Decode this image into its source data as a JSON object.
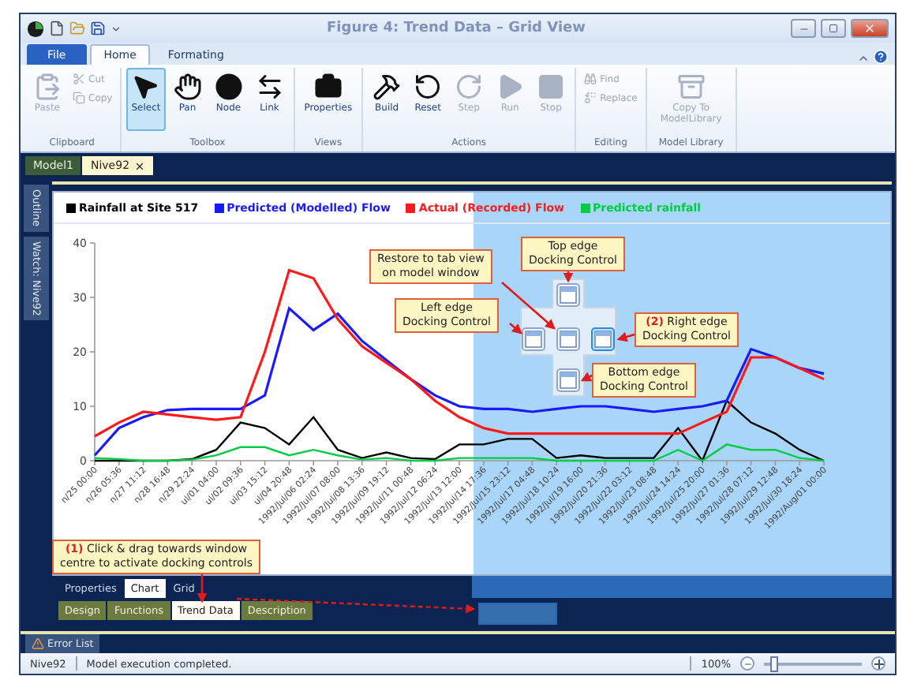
{
  "window": {
    "title": "Figure 4: Trend Data – Grid View"
  },
  "ribbon_tabs": [
    {
      "label": "File",
      "kind": "file",
      "selected": false
    },
    {
      "label": "Home",
      "kind": "tab",
      "selected": true
    },
    {
      "label": "Formating",
      "kind": "tab",
      "selected": false
    }
  ],
  "ribbon": {
    "groups": [
      {
        "label": "Clipboard",
        "buttons": [
          {
            "label": "Paste",
            "kind": "large",
            "disabled": true
          },
          {
            "label": "Cut",
            "kind": "small",
            "disabled": true
          },
          {
            "label": "Copy",
            "kind": "small",
            "disabled": true
          }
        ]
      },
      {
        "label": "Toolbox",
        "buttons": [
          {
            "label": "Select",
            "kind": "large",
            "disabled": false,
            "selected": true
          },
          {
            "label": "Pan",
            "kind": "large",
            "disabled": false,
            "selected": false
          },
          {
            "label": "Node",
            "kind": "large",
            "disabled": false,
            "selected": false
          },
          {
            "label": "Link",
            "kind": "large",
            "disabled": false,
            "selected": false
          }
        ]
      },
      {
        "label": "Views",
        "buttons": [
          {
            "label": "Properties",
            "kind": "large",
            "disabled": false
          }
        ]
      },
      {
        "label": "Actions",
        "buttons": [
          {
            "label": "Build",
            "kind": "large",
            "disabled": false
          },
          {
            "label": "Reset",
            "kind": "large",
            "disabled": false
          },
          {
            "label": "Step",
            "kind": "large",
            "disabled": true
          },
          {
            "label": "Run",
            "kind": "large",
            "disabled": true
          },
          {
            "label": "Stop",
            "kind": "large",
            "disabled": true
          }
        ]
      },
      {
        "label": "Editing",
        "buttons": [
          {
            "label": "Find",
            "kind": "small",
            "disabled": true
          },
          {
            "label": "Replace",
            "kind": "small",
            "disabled": true
          }
        ]
      },
      {
        "label": "Model Library",
        "buttons": [
          {
            "label": "Copy To ModelLibrary",
            "kind": "large",
            "disabled": true
          }
        ]
      }
    ]
  },
  "document_tabs": [
    {
      "label": "Model1",
      "selected": false,
      "closable": false
    },
    {
      "label": "Nive92",
      "selected": true,
      "closable": true
    }
  ],
  "side_tabs": [
    {
      "label": "Outline"
    },
    {
      "label": "Watch: Nive92"
    }
  ],
  "chart_data": {
    "type": "line",
    "categories": [
      "n/25 00:00",
      "n/26 05:36",
      "n/27 11:12",
      "n/28 16:48",
      "n/29 22:24",
      "ul/01 04:00",
      "ul/02 09:36",
      "ul/03 15:12",
      "ul/04 20:48",
      "1992/Jul/06 02:24",
      "1992/Jul/07 08:00",
      "1992/Jul/08 13:36",
      "1992/Jul/09 19:12",
      "1992/Jul/11 00:48",
      "1992/Jul/12 06:24",
      "1992/Jul/13 12:00",
      "1992/Jul/14 17:36",
      "1992/Jul/15 23:12",
      "1992/Jul/17 04:48",
      "1992/Jul/18 10:24",
      "1992/Jul/19 16:00",
      "1992/Jul/20 21:36",
      "1992/Jul/22 03:12",
      "1992/Jul/23 08:48",
      "1992/Jul/24 14:24",
      "1992/Jul/25 20:00",
      "1992/Jul/27 01:36",
      "1992/Jul/28 07:12",
      "1992/Jul/29 12:48",
      "1992/Jul/30 18:24",
      "1992/Aug/01 00:00"
    ],
    "series": [
      {
        "name": "Rainfall at Site 517",
        "color": "#000000",
        "values": [
          0,
          0,
          0,
          0,
          0.3,
          2,
          7,
          6,
          3,
          8,
          2,
          0.5,
          1.5,
          0.5,
          0.3,
          3,
          3,
          4,
          4,
          0.5,
          1,
          0.5,
          0.5,
          0.5,
          6,
          0,
          11,
          7,
          5,
          2,
          0
        ]
      },
      {
        "name": "Predicted (Modelled) Flow",
        "color": "#1a1aff",
        "values": [
          1,
          6,
          8,
          9.3,
          9.5,
          9.5,
          9.5,
          12,
          28,
          24,
          27,
          22,
          18.5,
          15,
          12,
          10,
          9.5,
          9.5,
          9,
          9.5,
          10,
          10,
          9.5,
          9,
          9.5,
          10,
          11,
          20.5,
          19,
          17,
          16
        ]
      },
      {
        "name": "Actual (Recorded) Flow",
        "color": "#ff1a1a",
        "values": [
          4.5,
          7,
          9,
          8.5,
          8,
          7.5,
          8,
          20,
          35,
          33.5,
          26,
          21,
          18,
          15,
          11,
          8,
          6,
          5,
          5,
          5,
          5,
          5,
          5,
          5,
          5,
          7,
          9,
          19,
          19,
          17,
          15
        ]
      },
      {
        "name": "Predicted rainfall",
        "color": "#00cc44",
        "values": [
          0.5,
          0.3,
          0,
          0,
          0.2,
          1,
          2.5,
          2.5,
          1,
          2,
          1,
          0.2,
          0.5,
          0,
          0,
          0.5,
          0.5,
          0.5,
          0.5,
          0,
          0,
          0,
          0,
          0,
          2,
          0,
          3,
          2,
          2,
          0.5,
          0
        ]
      }
    ],
    "ylim": [
      0,
      40
    ],
    "yticks": [
      0,
      10,
      20,
      30,
      40
    ]
  },
  "view_tabs": [
    {
      "label": "Properties",
      "selected": false
    },
    {
      "label": "Chart",
      "selected": true
    },
    {
      "label": "Grid",
      "selected": false
    }
  ],
  "editor_tabs": [
    {
      "label": "Design",
      "selected": false
    },
    {
      "label": "Functions",
      "selected": false
    },
    {
      "label": "Trend Data",
      "selected": true
    },
    {
      "label": "Description",
      "selected": false
    }
  ],
  "tool_window": {
    "label": "Error List"
  },
  "callouts": [
    {
      "lines": [
        "Top edge",
        "Docking Control"
      ]
    },
    {
      "lines": [
        "Restore to tab view",
        "on model window"
      ]
    },
    {
      "lines": [
        "Left edge",
        "Docking Control"
      ]
    },
    {
      "lines": [
        "**(2)** Right edge",
        "Docking Control"
      ]
    },
    {
      "lines": [
        "Bottom edge",
        "Docking Control"
      ]
    },
    {
      "lines": [
        "**(1)** Click & drag towards window",
        "centre to activate docking controls"
      ]
    }
  ],
  "status_bar": {
    "document": "Nive92",
    "message": "Model execution completed.",
    "zoom": "100%",
    "zoom_slider": {
      "level": 0.06
    }
  }
}
